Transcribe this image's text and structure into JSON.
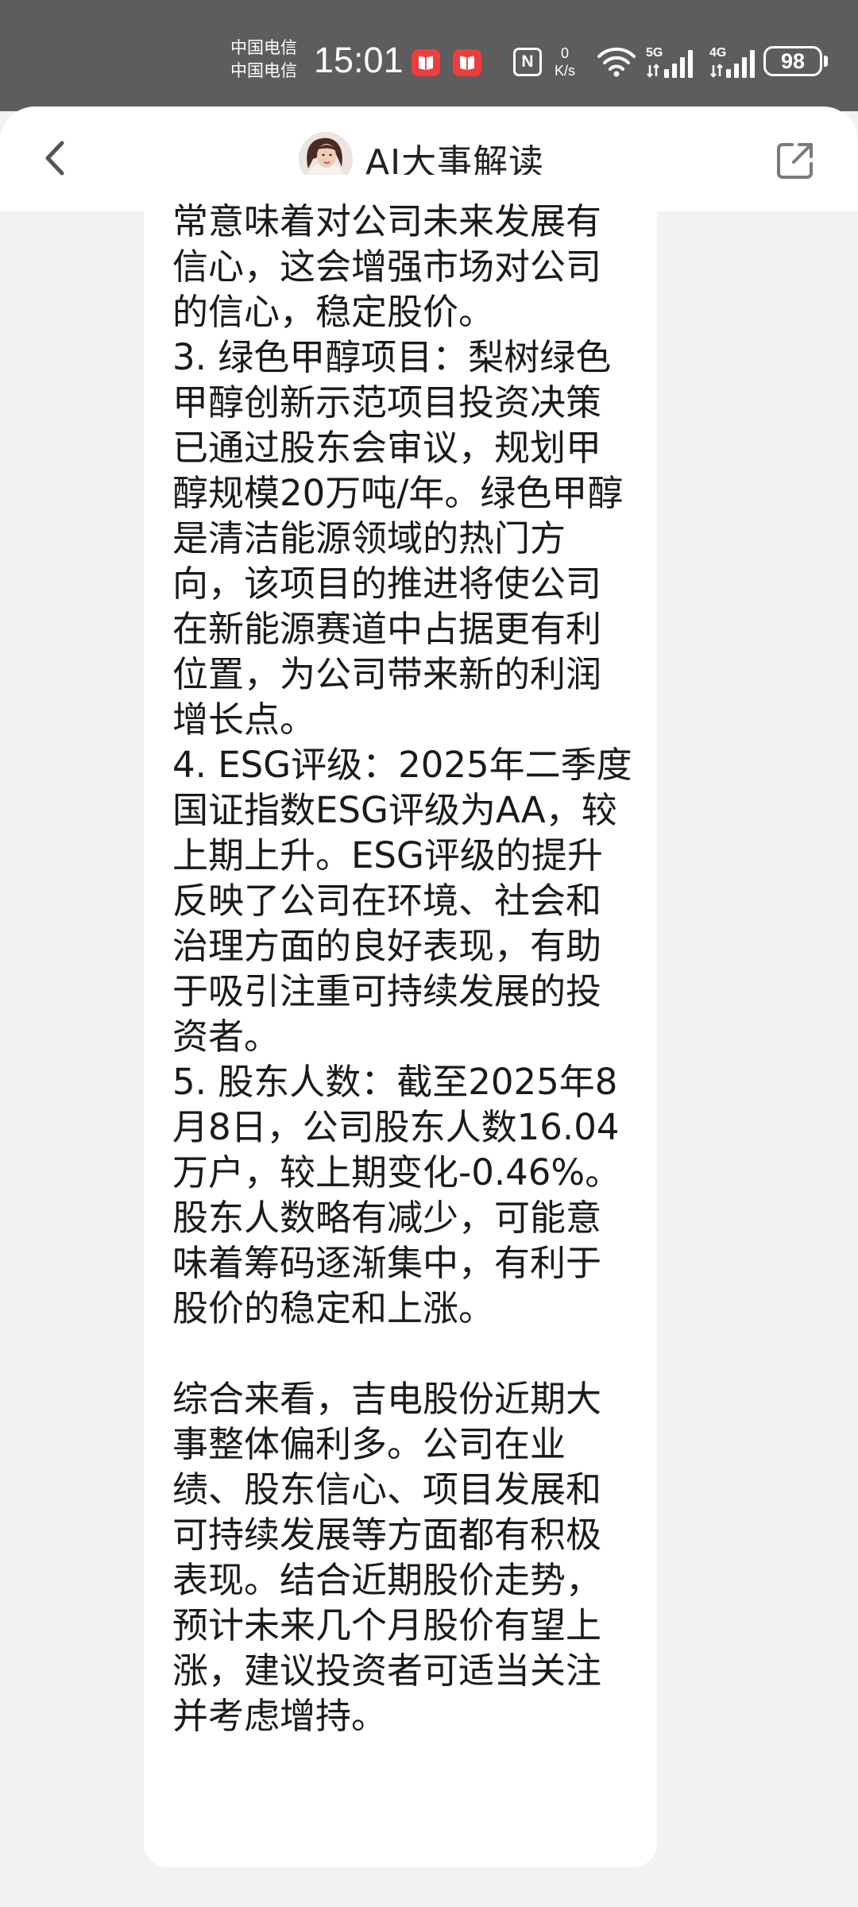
{
  "status_bar": {
    "carrier_1": "中国电信",
    "carrier_2": "中国电信",
    "time": "15:01",
    "net_speed_value": "0",
    "net_speed_unit": "K/s",
    "nfc_label": "N",
    "signal_1_label": "5G",
    "signal_2_label": "4G",
    "battery": "98",
    "icons": [
      "app-notification-icon",
      "app-notification-icon",
      "nfc-icon",
      "wifi-icon",
      "signal-5g-icon",
      "signal-4g-icon",
      "battery-icon"
    ]
  },
  "header": {
    "title": "AI大事解读",
    "back_icon": "chevron-left-icon",
    "share_icon": "share-external-icon"
  },
  "message": {
    "text": "常意味着对公司未来发展有信心，这会增强市场对公司的信心，稳定股价。\n3. 绿色甲醇项目：梨树绿色甲醇创新示范项目投资决策已通过股东会审议，规划甲醇规模20万吨/年。绿色甲醇是清洁能源领域的热门方向，该项目的推进将使公司在新能源赛道中占据更有利位置，为公司带来新的利润增长点。\n4. ESG评级：2025年二季度国证指数ESG评级为AA，较上期上升。ESG评级的提升反映了公司在环境、社会和治理方面的良好表现，有助于吸引注重可持续发展的投资者。\n5. 股东人数：截至2025年8月8日，公司股东人数16.04万户，较上期变化-0.46%。股东人数略有减少，可能意味着筹码逐渐集中，有利于股价的稳定和上涨。\n\n综合来看，吉电股份近期大事整体偏利多。公司在业绩、股东信心、项目发展和可持续发展等方面都有积极表现。结合近期股价走势，预计未来几个月股价有望上涨，建议投资者可适当关注并考虑增持。"
  },
  "colors": {
    "status_bar_bg": "#5d5d5d",
    "page_bg": "#f2f2f2",
    "card_bg": "#ffffff",
    "text": "#1a1a1a",
    "badge_red": "#ef3c3c"
  }
}
